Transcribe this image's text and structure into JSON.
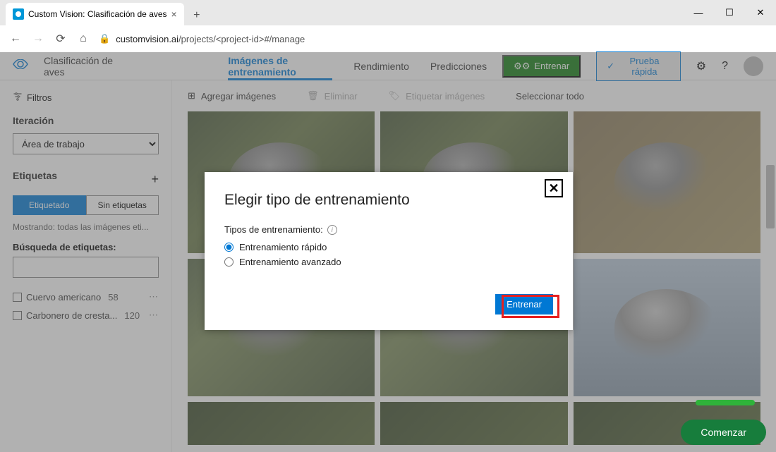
{
  "browser": {
    "tab_title": "Custom Vision: Clasificación de aves",
    "url_host": "customvision.ai",
    "url_path": "/projects/<project-id>#/manage"
  },
  "header": {
    "project_name": "Clasificación de aves",
    "tabs": {
      "training_images": "Imágenes de entrenamiento",
      "performance": "Rendimiento",
      "predictions": "Predicciones"
    },
    "train_button": "Entrenar",
    "quick_test_button": "Prueba rápida"
  },
  "sidebar": {
    "filters_label": "Filtros",
    "iteration_label": "Iteración",
    "iteration_select": "Área de trabajo",
    "tags_label": "Etiquetas",
    "tagged_btn": "Etiquetado",
    "untagged_btn": "Sin etiquetas",
    "showing_text": "Mostrando: todas las imágenes eti...",
    "search_label": "Búsqueda de etiquetas:",
    "tags": [
      {
        "name": "Cuervo americano",
        "count": "58"
      },
      {
        "name": "Carbonero de cresta...",
        "count": "120"
      }
    ]
  },
  "toolbar": {
    "add_images": "Agregar imágenes",
    "delete": "Eliminar",
    "tag_images": "Etiquetar imágenes",
    "select_all": "Seleccionar todo"
  },
  "modal": {
    "title": "Elegir tipo de entrenamiento",
    "subtitle": "Tipos de entrenamiento:",
    "option_quick": "Entrenamiento rápido",
    "option_advanced": "Entrenamiento avanzado",
    "submit": "Entrenar"
  },
  "footer": {
    "comenzar": "Comenzar"
  }
}
